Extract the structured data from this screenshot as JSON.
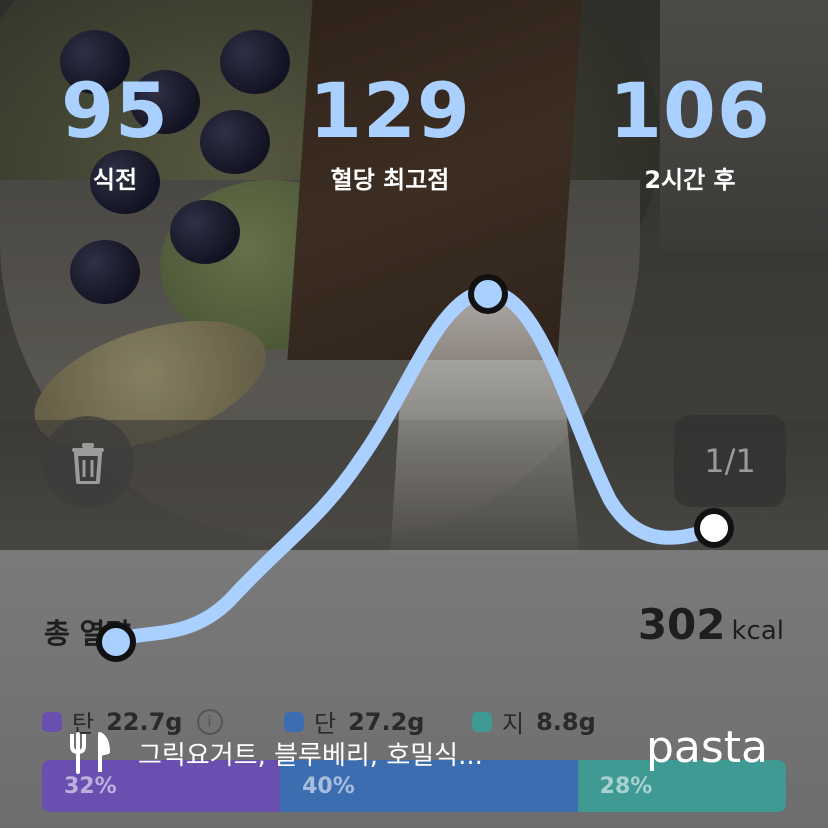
{
  "stats": {
    "before": {
      "value": "95",
      "label": "식전"
    },
    "peak": {
      "value": "129",
      "label": "혈당 최고점"
    },
    "after": {
      "value": "106",
      "label": "2시간 후"
    }
  },
  "pager": {
    "label": "1/1"
  },
  "calories": {
    "label": "총 열량",
    "value": "302",
    "unit": "kcal"
  },
  "macros": [
    {
      "name": "탄",
      "value": "22.7g",
      "color": "#6a4fb0",
      "percent": 32,
      "percent_label": "32%"
    },
    {
      "name": "단",
      "value": "27.2g",
      "color": "#3c6db0",
      "percent": 40,
      "percent_label": "40%"
    },
    {
      "name": "지",
      "value": "8.8g",
      "color": "#3f9a94",
      "percent": 28,
      "percent_label": "28%"
    }
  ],
  "food": {
    "name": "그릭요거트, 블루베리, 호밀식..."
  },
  "brand": "pasta",
  "curve": {
    "color": "#a9d0ff",
    "points": [
      95,
      129,
      106
    ]
  },
  "icons": {
    "delete": "trash-icon",
    "food": "utensils-icon",
    "info": "info-icon"
  }
}
